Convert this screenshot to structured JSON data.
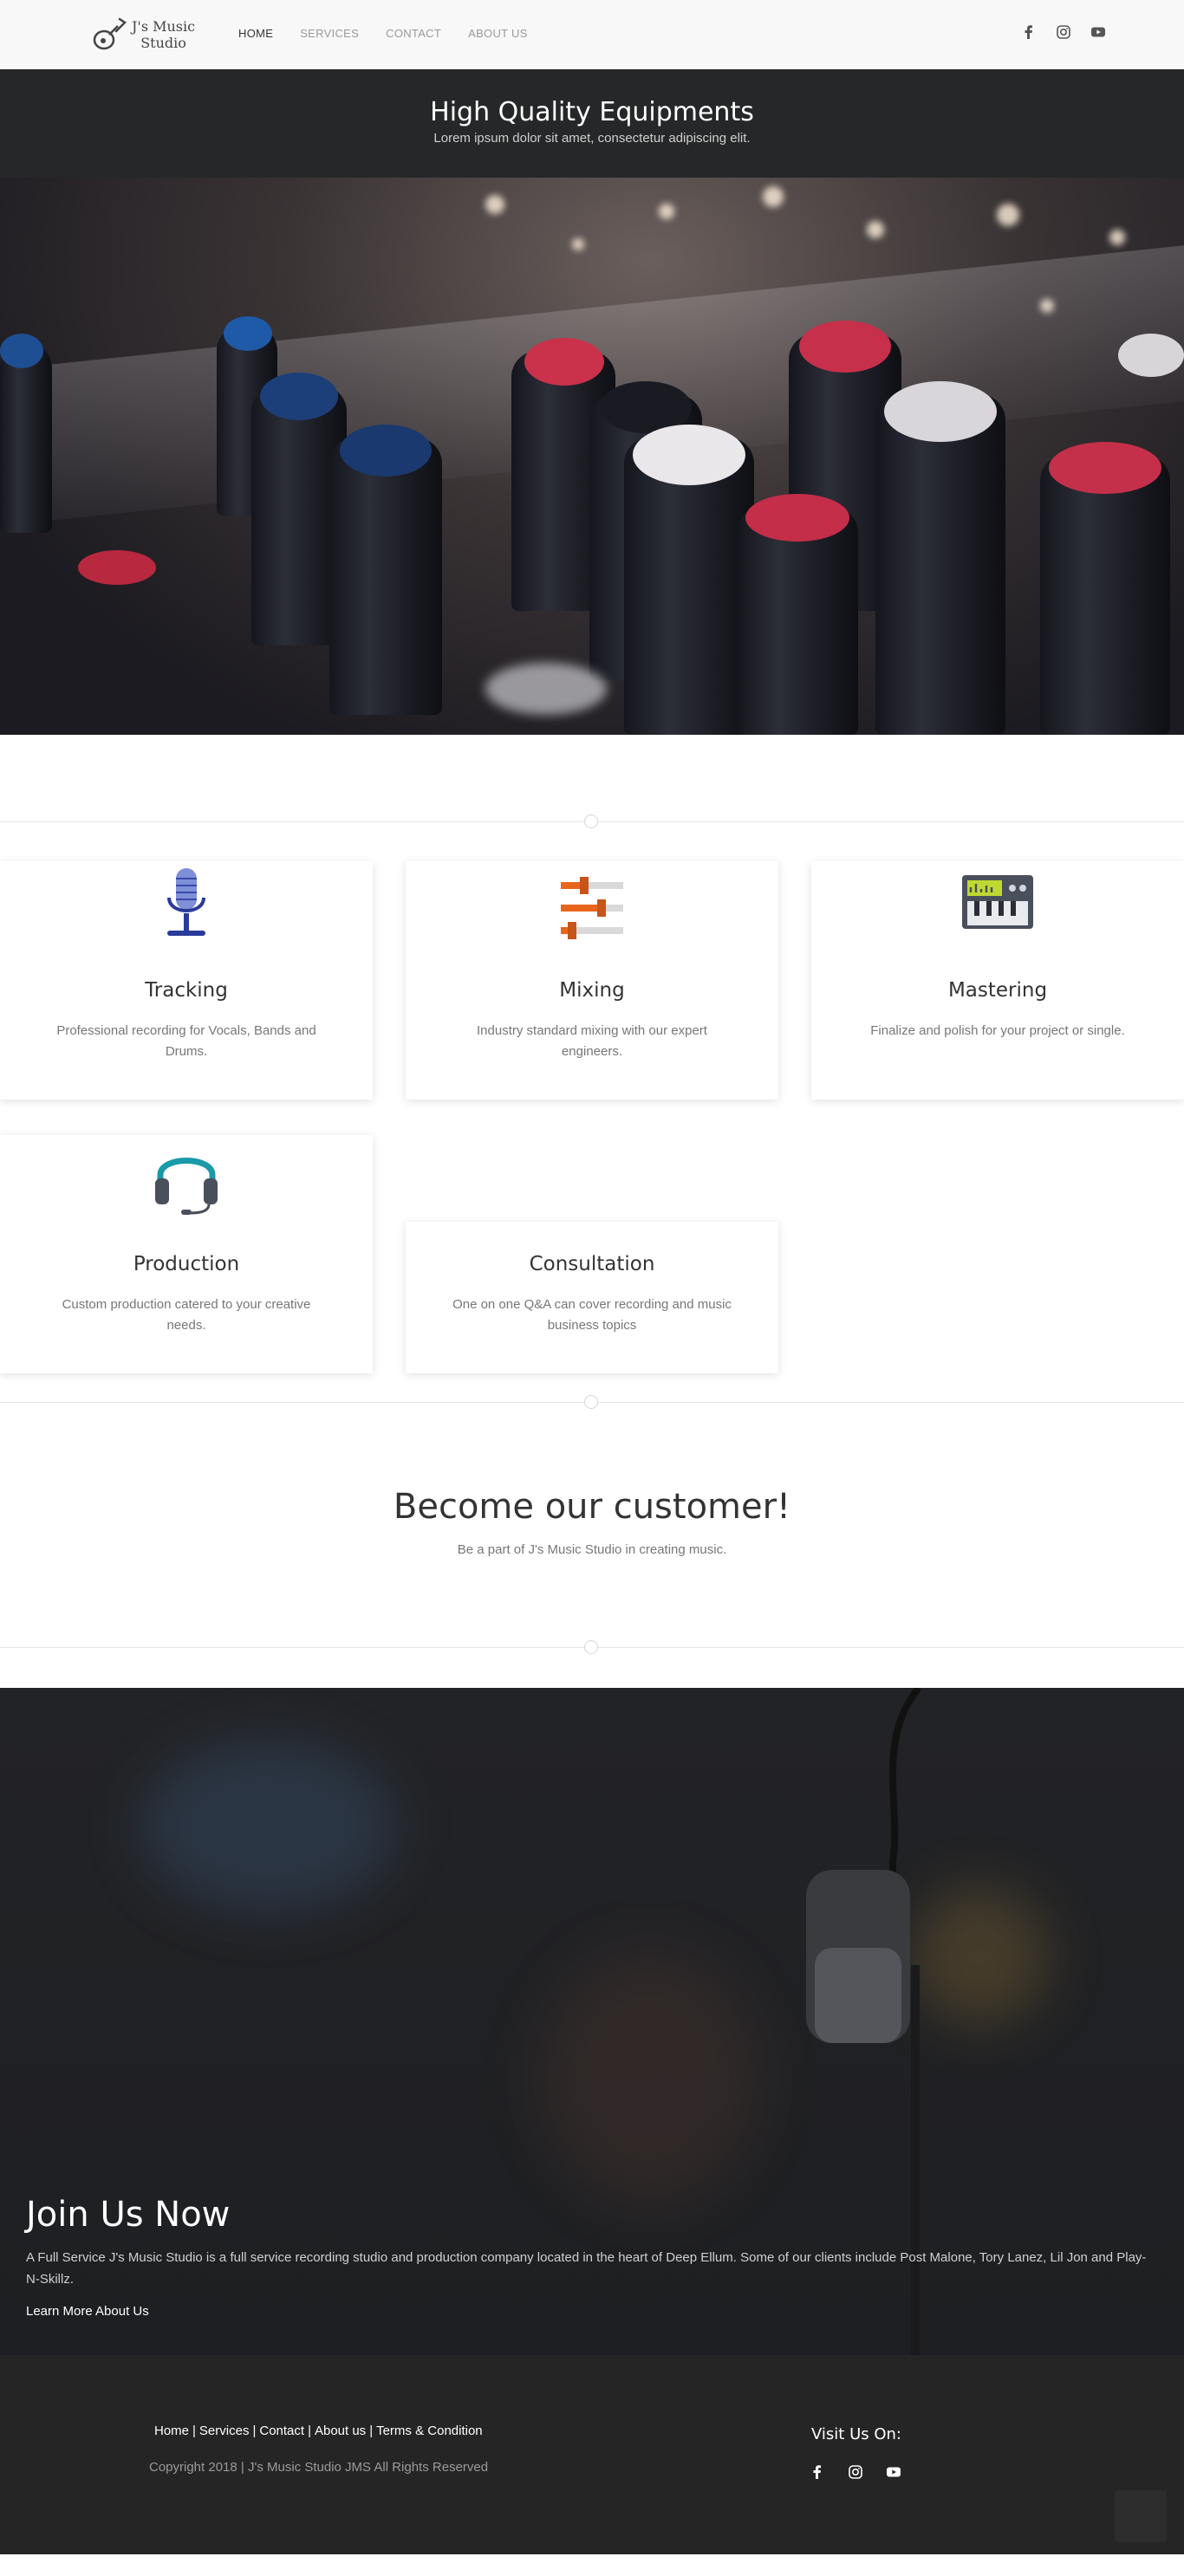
{
  "nav": {
    "logo_line1": "J's Music",
    "logo_line2": "Studio",
    "links": [
      "HOME",
      "SERVICES",
      "CONTACT",
      "ABOUT US"
    ],
    "social_icons": [
      "facebook-icon",
      "instagram-icon",
      "youtube-icon"
    ]
  },
  "hero": {
    "title": "High Quality Equipments",
    "subtitle": "Lorem ipsum dolor sit amet, consectetur adipiscing elit."
  },
  "services": [
    {
      "title": "Tracking",
      "description": "Professional recording for Vocals, Bands and Drums.",
      "icon": "microphone-icon"
    },
    {
      "title": "Mixing",
      "description": "Industry standard mixing with our expert engineers.",
      "icon": "sliders-icon"
    },
    {
      "title": "Mastering",
      "description": "Finalize and polish for your project or single.",
      "icon": "synthesizer-icon"
    },
    {
      "title": "Production",
      "description": "Custom production catered to your creative needs.",
      "icon": "headphones-icon"
    },
    {
      "title": "Consultation",
      "description": "One on one Q&A can cover recording and music business topics",
      "icon": ""
    }
  ],
  "become": {
    "title": "Become our customer!",
    "subtitle": "Be a part of J's Music Studio in creating music."
  },
  "join": {
    "title": "Join Us Now",
    "text": "A Full Service J's Music Studio is a full service recording studio and production company located in the heart of Deep Ellum. Some of our clients include Post Malone, Tory Lanez, Lil Jon and Play-N-Skillz.",
    "link": "Learn More About Us"
  },
  "footer": {
    "links": [
      "Home",
      "Services",
      "Contact",
      "About us",
      "Terms & Condition"
    ],
    "copyright": "Copyright 2018 | J's Music Studio JMS All Rights Reserved",
    "visit": "Visit Us On:"
  },
  "colors": {
    "dark_bar": "#262728",
    "footer_bg": "#252525",
    "slider_orange": "#e8661c",
    "headphone_teal": "#1a9aa8",
    "mic_blue": "#3949ab"
  }
}
